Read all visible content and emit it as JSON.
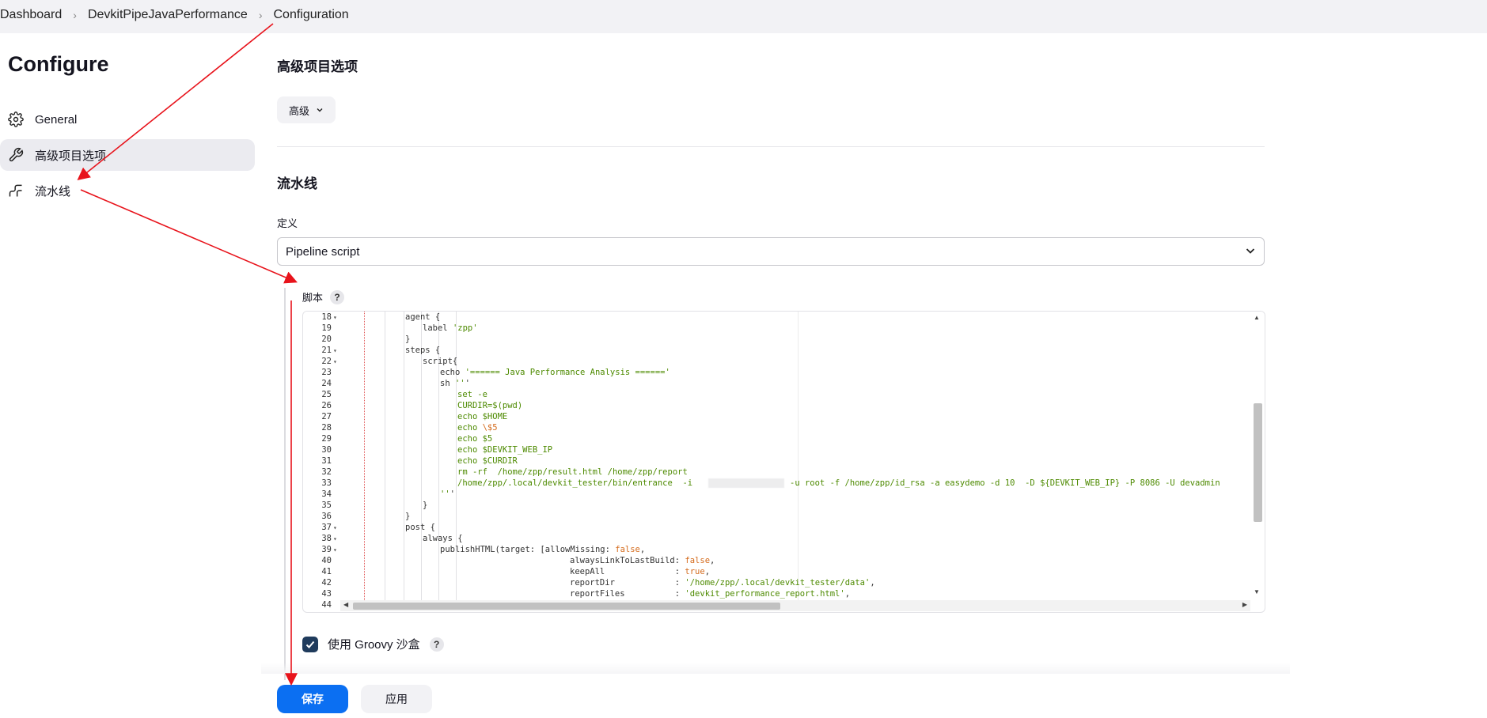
{
  "breadcrumb": [
    "Dashboard",
    "DevkitPipeJavaPerformance",
    "Configuration"
  ],
  "sidebar": {
    "title": "Configure",
    "items": [
      {
        "label": "General",
        "icon": "gear-icon",
        "active": false
      },
      {
        "label": "高级项目选项",
        "icon": "wrench-icon",
        "active": true
      },
      {
        "label": "流水线",
        "icon": "pipeline-icon",
        "active": false
      }
    ]
  },
  "advanced": {
    "title": "高级项目选项",
    "button_label": "高级"
  },
  "pipeline": {
    "title": "流水线",
    "definition_label": "定义",
    "definition_value": "Pipeline script",
    "script_label": "脚本",
    "help_glyph": "?"
  },
  "code_lines": [
    {
      "n": "18",
      "fold": true,
      "text": "agent {"
    },
    {
      "n": "19",
      "fold": false,
      "text": "label 'zpp'"
    },
    {
      "n": "20",
      "fold": false,
      "text": "}"
    },
    {
      "n": "21",
      "fold": true,
      "text": "steps {"
    },
    {
      "n": "22",
      "fold": true,
      "text": "script{"
    },
    {
      "n": "23",
      "fold": false,
      "text": "echo '====== Java Performance Analysis ======'"
    },
    {
      "n": "24",
      "fold": false,
      "text": "sh '''"
    },
    {
      "n": "25",
      "fold": false,
      "text": "set -e"
    },
    {
      "n": "26",
      "fold": false,
      "text": "CURDIR=$(pwd)"
    },
    {
      "n": "27",
      "fold": false,
      "text": "echo $HOME"
    },
    {
      "n": "28",
      "fold": false,
      "text": "echo \\$5"
    },
    {
      "n": "29",
      "fold": false,
      "text": "echo $5"
    },
    {
      "n": "30",
      "fold": false,
      "text": "echo $DEVKIT_WEB_IP"
    },
    {
      "n": "31",
      "fold": false,
      "text": "echo $CURDIR"
    },
    {
      "n": "32",
      "fold": false,
      "text": "rm -rf  /home/zpp/result.html /home/zpp/report"
    },
    {
      "n": "33",
      "fold": false,
      "text": "/home/zpp/.local/devkit_tester/bin/entrance  -i"
    },
    {
      "n": "34",
      "fold": false,
      "text": "'''"
    },
    {
      "n": "35",
      "fold": false,
      "text": "}"
    },
    {
      "n": "36",
      "fold": false,
      "text": "}"
    },
    {
      "n": "37",
      "fold": true,
      "text": "post {"
    },
    {
      "n": "38",
      "fold": true,
      "text": "always {"
    },
    {
      "n": "39",
      "fold": true,
      "text": "publishHTML(target: [allowMissing: false,"
    },
    {
      "n": "40",
      "fold": false,
      "text": "alwaysLinkToLastBuild: false,"
    },
    {
      "n": "41",
      "fold": false,
      "text": "keepAll              : true,"
    },
    {
      "n": "42",
      "fold": false,
      "text": "reportDir            : '/home/zpp/.local/devkit_tester/data',"
    },
    {
      "n": "43",
      "fold": false,
      "text": "reportFiles          : 'devkit_performance_report.html',"
    },
    {
      "n": "44",
      "fold": false,
      "text": ""
    }
  ],
  "line33_tail": "-u root -f /home/zpp/id_rsa -a easydemo -d 10  -D ${DEVKIT_WEB_IP} -P 8086 -U devadmin",
  "groovy": {
    "label": "使用 Groovy 沙盒",
    "checked": true
  },
  "buttons": {
    "save": "保存",
    "apply": "应用"
  },
  "colors": {
    "primary": "#0b6ff2",
    "checkbox": "#1f3b5c",
    "annotation_arrow": "#e8131b",
    "string": "#4d8a00",
    "boolean": "#d46a1b"
  }
}
